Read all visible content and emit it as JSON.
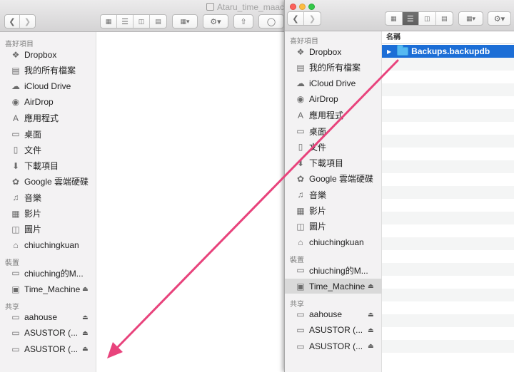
{
  "back_window": {
    "title": "Ataru_time_maach",
    "sidebar": {
      "favorites_heading": "喜好項目",
      "favorites": [
        {
          "label": "Dropbox",
          "icon": "dropbox-icon",
          "glyph": "❖"
        },
        {
          "label": "我的所有檔案",
          "icon": "all-my-files-icon",
          "glyph": "▤"
        },
        {
          "label": "iCloud Drive",
          "icon": "cloud-icon",
          "glyph": "☁"
        },
        {
          "label": "AirDrop",
          "icon": "airdrop-icon",
          "glyph": "◉"
        },
        {
          "label": "應用程式",
          "icon": "applications-icon",
          "glyph": "A"
        },
        {
          "label": "桌面",
          "icon": "desktop-icon",
          "glyph": "▭"
        },
        {
          "label": "文件",
          "icon": "documents-icon",
          "glyph": "▯"
        },
        {
          "label": "下載項目",
          "icon": "downloads-icon",
          "glyph": "⬇"
        },
        {
          "label": "Google 雲端硬碟",
          "icon": "google-drive-icon",
          "glyph": "✿"
        },
        {
          "label": "音樂",
          "icon": "music-icon",
          "glyph": "♫"
        },
        {
          "label": "影片",
          "icon": "movies-icon",
          "glyph": "▦"
        },
        {
          "label": "圖片",
          "icon": "pictures-icon",
          "glyph": "◫"
        },
        {
          "label": "chiuchingkuan",
          "icon": "home-icon",
          "glyph": "⌂"
        }
      ],
      "devices_heading": "裝置",
      "devices": [
        {
          "label": "chiuching的M...",
          "icon": "laptop-icon",
          "glyph": "▭",
          "eject": false
        },
        {
          "label": "Time_Machine",
          "icon": "disk-icon",
          "glyph": "▣",
          "eject": true
        }
      ],
      "shared_heading": "共享",
      "shared": [
        {
          "label": "aahouse",
          "icon": "server-icon",
          "glyph": "▭",
          "eject": true
        },
        {
          "label": "ASUSTOR (...",
          "icon": "server-icon",
          "glyph": "▭",
          "eject": true
        },
        {
          "label": "ASUSTOR (...",
          "icon": "server-icon",
          "glyph": "▭",
          "eject": true
        }
      ]
    }
  },
  "front_window": {
    "sidebar": {
      "favorites_heading": "喜好項目",
      "favorites": [
        {
          "label": "Dropbox",
          "icon": "dropbox-icon",
          "glyph": "❖"
        },
        {
          "label": "我的所有檔案",
          "icon": "all-my-files-icon",
          "glyph": "▤"
        },
        {
          "label": "iCloud Drive",
          "icon": "cloud-icon",
          "glyph": "☁"
        },
        {
          "label": "AirDrop",
          "icon": "airdrop-icon",
          "glyph": "◉"
        },
        {
          "label": "應用程式",
          "icon": "applications-icon",
          "glyph": "A"
        },
        {
          "label": "桌面",
          "icon": "desktop-icon",
          "glyph": "▭"
        },
        {
          "label": "文件",
          "icon": "documents-icon",
          "glyph": "▯"
        },
        {
          "label": "下載項目",
          "icon": "downloads-icon",
          "glyph": "⬇"
        },
        {
          "label": "Google 雲端硬碟",
          "icon": "google-drive-icon",
          "glyph": "✿"
        },
        {
          "label": "音樂",
          "icon": "music-icon",
          "glyph": "♫"
        },
        {
          "label": "影片",
          "icon": "movies-icon",
          "glyph": "▦"
        },
        {
          "label": "圖片",
          "icon": "pictures-icon",
          "glyph": "◫"
        },
        {
          "label": "chiuchingkuan",
          "icon": "home-icon",
          "glyph": "⌂"
        }
      ],
      "devices_heading": "裝置",
      "devices": [
        {
          "label": "chiuching的M...",
          "icon": "laptop-icon",
          "glyph": "▭",
          "eject": false
        },
        {
          "label": "Time_Machine",
          "icon": "disk-icon",
          "glyph": "▣",
          "eject": true,
          "selected": true
        }
      ],
      "shared_heading": "共享",
      "shared": [
        {
          "label": "aahouse",
          "icon": "server-icon",
          "glyph": "▭",
          "eject": true
        },
        {
          "label": "ASUSTOR (...",
          "icon": "server-icon",
          "glyph": "▭",
          "eject": true
        },
        {
          "label": "ASUSTOR (...",
          "icon": "server-icon",
          "glyph": "▭",
          "eject": true
        }
      ]
    },
    "list": {
      "column_header": "名稱",
      "selected_item": "Backups.backupdb"
    }
  },
  "annotation": {
    "color": "#e8437c"
  }
}
